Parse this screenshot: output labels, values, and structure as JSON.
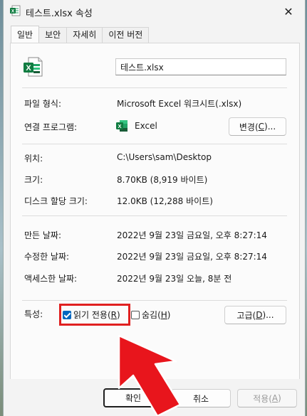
{
  "window": {
    "title": "테스트.xlsx 속성",
    "close_glyph": "✕"
  },
  "tabs": [
    {
      "label": "일반"
    },
    {
      "label": "보안"
    },
    {
      "label": "자세히"
    },
    {
      "label": "이전 버전"
    }
  ],
  "general": {
    "file_name": "테스트.xlsx",
    "file_type_label": "파일 형식:",
    "file_type_value": "Microsoft Excel 워크시트(.xlsx)",
    "opens_with_label": "연결 프로그램:",
    "opens_with_value": "Excel",
    "change_button_prefix": "변경(",
    "change_button_key": "C",
    "change_button_suffix": ")...",
    "location_label": "위치:",
    "location_value": "C:\\Users\\sam\\Desktop",
    "size_label": "크기:",
    "size_value": "8.70KB (8,919 바이트)",
    "size_on_disk_label": "디스크 할당 크기:",
    "size_on_disk_value": "12.0KB (12,288 바이트)",
    "created_label": "만든 날짜:",
    "created_value": "2022년 9월 23일 금요일, 오후 8:27:14",
    "modified_label": "수정한 날짜:",
    "modified_value": "2022년 9월 23일 금요일, 오후 8:27:14",
    "accessed_label": "액세스한 날짜:",
    "accessed_value": "2022년 9월 23일 오늘, 8분 전",
    "attributes_label": "특성:",
    "readonly_prefix": "읽기 전용(",
    "readonly_key": "R",
    "readonly_suffix": ")",
    "readonly_checked": true,
    "hidden_prefix": "숨김(",
    "hidden_key": "H",
    "hidden_suffix": ")",
    "hidden_checked": false,
    "advanced_prefix": "고급(",
    "advanced_key": "D",
    "advanced_suffix": ")..."
  },
  "footer": {
    "ok_label": "확인",
    "cancel_label": "취소",
    "apply_prefix": "적용(",
    "apply_key": "A",
    "apply_suffix": ")"
  },
  "colors": {
    "excel_green": "#107c41",
    "checkbox_blue": "#0067c0",
    "annotation_red": "#e02020"
  },
  "icons": {
    "title": "excel-file-icon",
    "file": "excel-file-icon",
    "app": "excel-app-icon",
    "annotation": "red-arrow-annotation"
  }
}
